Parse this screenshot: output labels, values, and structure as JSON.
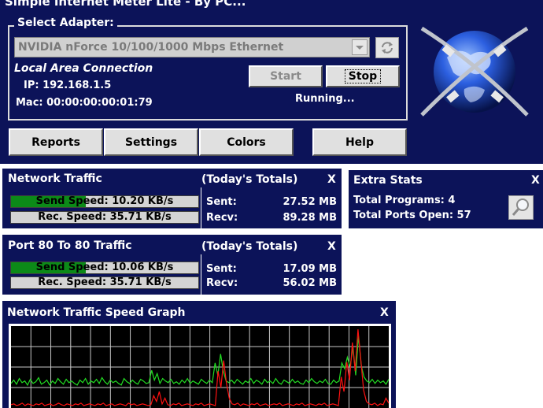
{
  "window": {
    "title": "Simple Internet Meter Lite - By PC... "
  },
  "adapter": {
    "group_label": "Select Adapter:",
    "selected": "NVIDIA nForce 10/100/1000 Mbps Ethernet",
    "connection_name": "Local Area Connection",
    "ip_text": "IP: 192.168.1.5",
    "mac_text": "Mac: 00:00:00:00:01:79",
    "start_label": "Start",
    "stop_label": "Stop",
    "status": "Running..."
  },
  "nav": {
    "reports": "Reports",
    "settings": "Settings",
    "colors": "Colors",
    "help": "Help"
  },
  "network_traffic": {
    "title": "Network Traffic",
    "totals_title": "(Today's Totals)",
    "close": "X",
    "send_label": "Send Speed: 10.20 KB/s",
    "send_fraction": 0.4,
    "rec_label": "Rec. Speed: 35.71 KB/s",
    "rec_fraction": 0.0,
    "sent_label": "Sent:",
    "sent_value": "27.52 MB",
    "recv_label": "Recv:",
    "recv_value": "89.28 MB"
  },
  "port_traffic": {
    "title": "Port 80 To 80 Traffic",
    "totals_title": "(Today's Totals)",
    "close": "X",
    "send_label": "Send Speed: 10.06 KB/s",
    "send_fraction": 0.4,
    "rec_label": "Rec. Speed: 35.71 KB/s",
    "rec_fraction": 0.0,
    "sent_label": "Sent:",
    "sent_value": "17.09 MB",
    "recv_label": "Recv:",
    "recv_value": "56.02 MB"
  },
  "extra_stats": {
    "title": "Extra Stats",
    "close": "X",
    "programs": "Total Programs: 4",
    "ports": "Total Ports Open: 57"
  },
  "graph": {
    "title": "Network Traffic Speed Graph",
    "close": "X",
    "colors": {
      "send": "#22dd22",
      "receive": "#ff1111",
      "grid": "#c8c8c8",
      "background": "#000000"
    }
  },
  "chart_data": {
    "type": "line",
    "grid": true,
    "ylim": [
      0,
      100
    ],
    "series": [
      {
        "color": "#22dd22",
        "values": [
          30,
          34,
          29,
          36,
          31,
          33,
          28,
          35,
          30,
          32,
          37,
          29,
          31,
          34,
          28,
          33,
          30,
          36,
          32,
          29,
          35,
          31,
          33,
          30,
          28,
          34,
          31,
          36,
          29,
          33,
          31,
          35,
          30,
          37,
          32,
          29,
          34,
          31,
          33,
          30,
          28,
          36,
          32,
          30,
          34,
          31,
          29,
          35,
          33,
          30,
          31,
          46,
          34,
          42,
          30,
          36,
          33,
          31,
          35,
          30,
          32,
          29,
          34,
          31,
          36,
          30,
          33,
          31,
          29,
          35,
          32,
          30,
          34,
          31,
          55,
          40,
          66,
          45,
          33,
          31,
          34,
          30,
          35,
          32,
          29,
          33,
          31,
          36,
          30,
          34,
          32,
          29,
          35,
          31,
          33,
          30,
          36,
          31,
          29,
          34,
          32,
          30,
          35,
          31,
          33,
          30,
          29,
          34,
          31,
          36,
          32,
          30,
          33,
          31,
          35,
          30,
          29,
          34,
          31,
          33,
          55,
          48,
          62,
          50,
          75,
          40,
          88,
          52,
          38,
          33,
          31,
          35,
          30,
          34,
          31,
          33,
          29,
          35
        ]
      },
      {
        "color": "#ff1111",
        "values": [
          4,
          5,
          3,
          4,
          6,
          3,
          5,
          4,
          3,
          5,
          4,
          6,
          3,
          4,
          5,
          3,
          4,
          6,
          4,
          3,
          5,
          4,
          3,
          5,
          4,
          6,
          3,
          4,
          5,
          4,
          3,
          5,
          4,
          6,
          3,
          4,
          5,
          3,
          4,
          5,
          4,
          3,
          6,
          4,
          5,
          3,
          4,
          5,
          4,
          3,
          4,
          15,
          8,
          20,
          5,
          12,
          4,
          3,
          5,
          4,
          6,
          3,
          4,
          5,
          4,
          3,
          5,
          4,
          6,
          3,
          4,
          5,
          4,
          3,
          45,
          25,
          58,
          30,
          12,
          5,
          4,
          6,
          3,
          5,
          4,
          3,
          5,
          4,
          6,
          3,
          4,
          5,
          3,
          4,
          5,
          4,
          6,
          3,
          4,
          5,
          4,
          3,
          5,
          4,
          6,
          3,
          4,
          5,
          4,
          3,
          5,
          4,
          6,
          3,
          4,
          5,
          4,
          3,
          38,
          20,
          56,
          34,
          80,
          45,
          96,
          60,
          22,
          8,
          5,
          4,
          6,
          3,
          5,
          4,
          12,
          6
        ]
      }
    ]
  },
  "icons": {
    "refresh": "refresh-icon",
    "search": "magnifier-icon",
    "globe": "network-globe-logo",
    "dropdown": "chevron-down-icon"
  }
}
